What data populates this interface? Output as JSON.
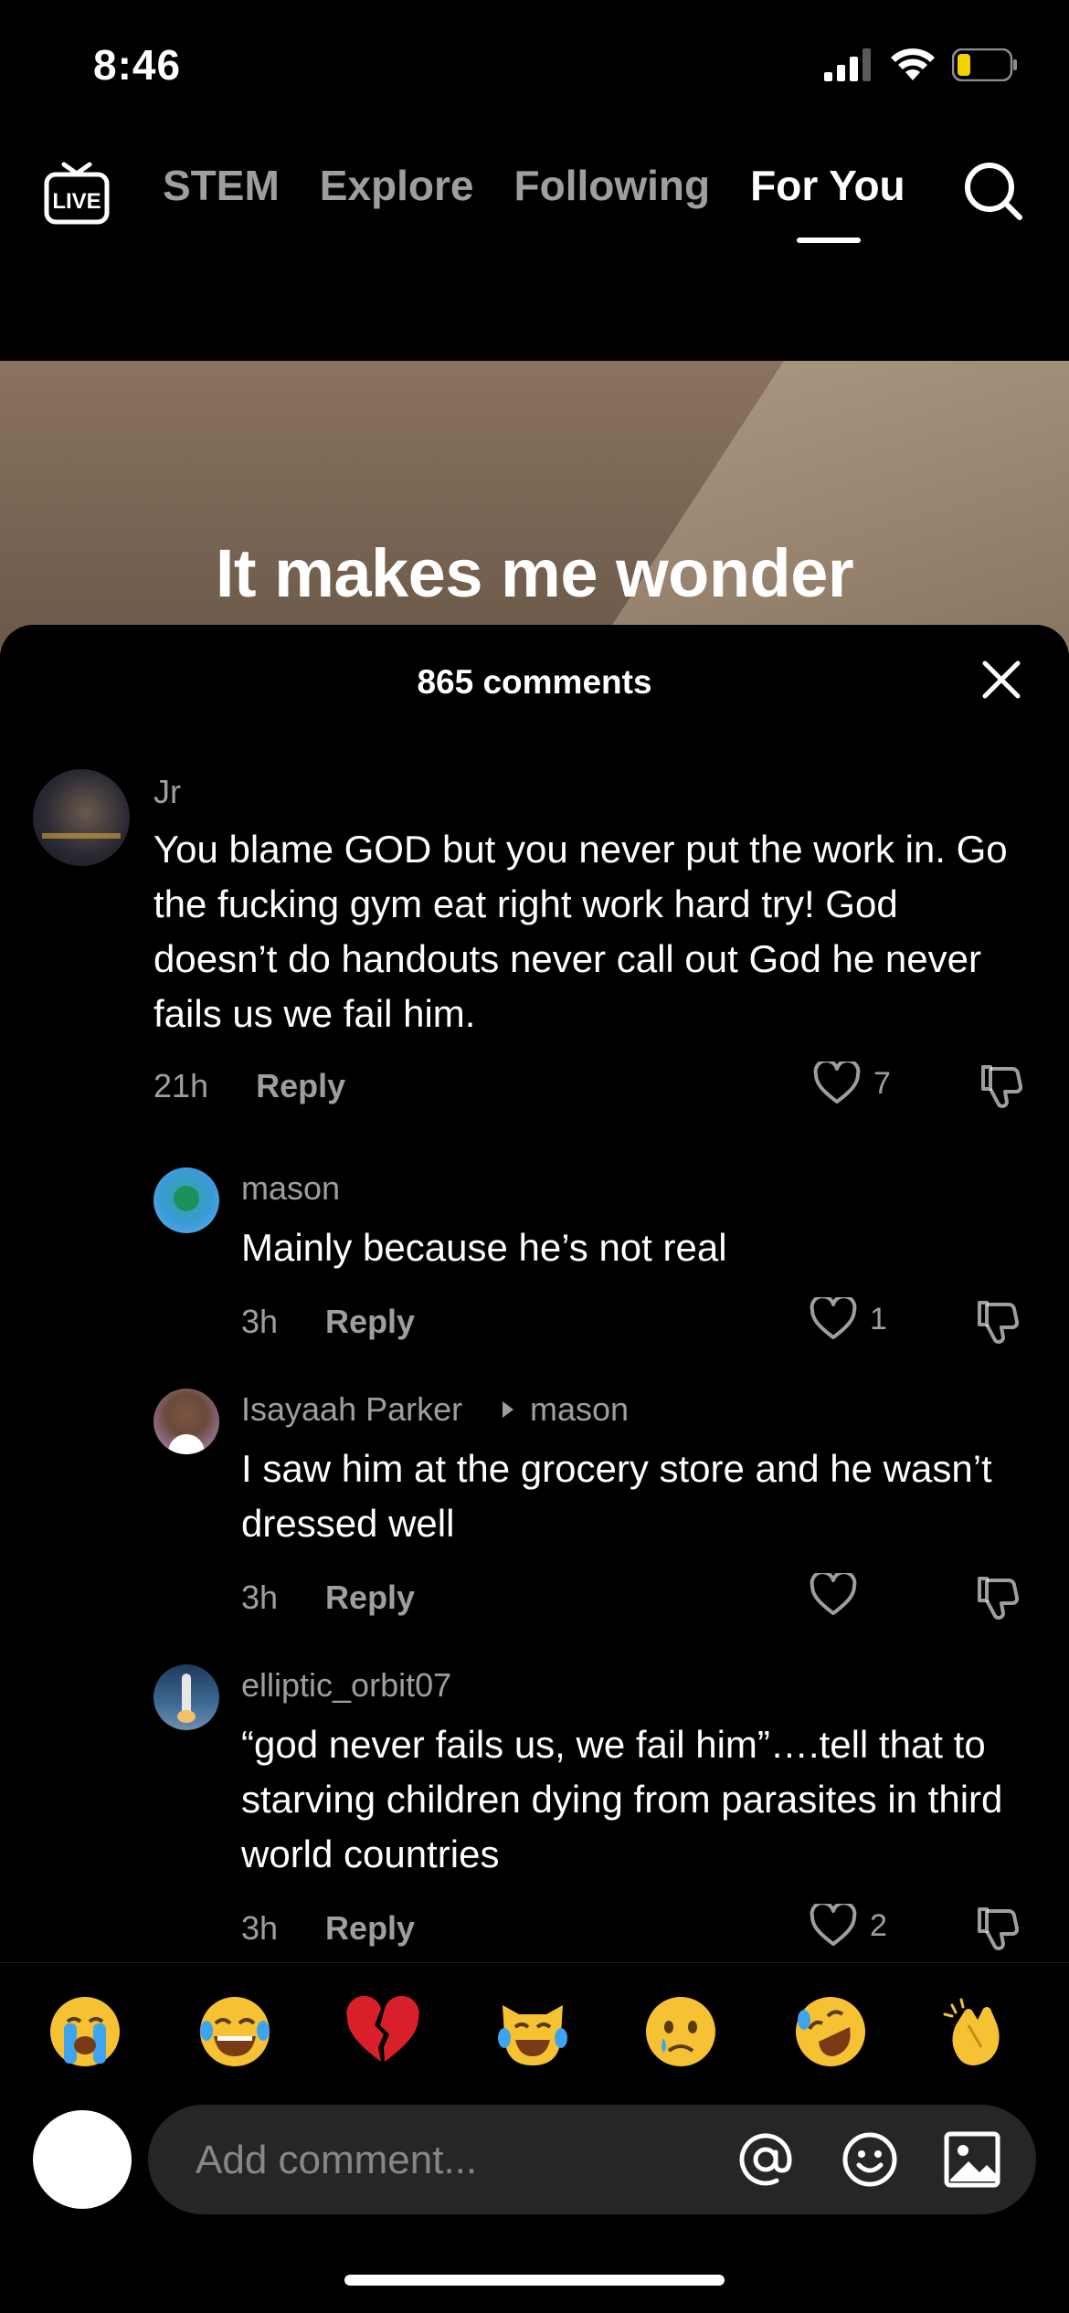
{
  "status_bar": {
    "time": "8:46",
    "battery_color": "#f5d000"
  },
  "top_nav": {
    "tabs": [
      "STEM",
      "Explore",
      "Following",
      "For You"
    ],
    "active_tab": "For You"
  },
  "video": {
    "caption": "It makes me wonder"
  },
  "comments_sheet": {
    "title": "865 comments",
    "reply_label": "Reply",
    "comments": [
      {
        "username": "Jr",
        "text": "You blame GOD but you never put the work in. Go the fucking gym eat right work hard try! God doesn’t do handouts never call out God he never fails us we fail him.",
        "time": "21h",
        "likes": "7"
      },
      {
        "username": "mason",
        "text": "Mainly because he’s not real",
        "time": "3h",
        "likes": "1"
      },
      {
        "username": "Isayaah Parker",
        "reply_to": "mason",
        "text": "I saw him at the grocery store and he wasn’t dressed well",
        "time": "3h",
        "likes": ""
      },
      {
        "username": "elliptic_orbit07",
        "text": "“god never fails us, we fail him”….tell that to starving children dying from parasites in third world countries",
        "time": "3h",
        "likes": "2"
      }
    ]
  },
  "emoji_bar": [
    "😭",
    "😂",
    "💔",
    "😹",
    "😢",
    "🤣",
    "👏"
  ],
  "composer": {
    "placeholder": "Add comment..."
  }
}
